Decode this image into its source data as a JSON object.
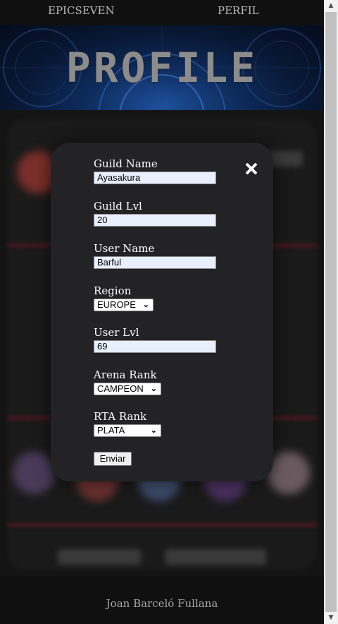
{
  "nav": {
    "home_link": "EPICSEVEN",
    "profile_link": "PERFIL"
  },
  "hero": {
    "title": "PROFILE"
  },
  "footer": {
    "author": "Joan Barceló Fullana"
  },
  "colors": {
    "modal_bg": "#232325",
    "input_autofill_bg": "#e8f0fe",
    "accent_line": "#5a1622"
  },
  "modal": {
    "close_icon": "close-icon",
    "fields": {
      "guild_name": {
        "label": "Guild Name",
        "value": "Ayasakura"
      },
      "guild_lvl": {
        "label": "Guild Lvl",
        "value": "20"
      },
      "user_name": {
        "label": "User Name",
        "value": "Barful"
      },
      "region": {
        "label": "Region",
        "selected": "EUROPE"
      },
      "user_lvl": {
        "label": "User Lvl",
        "value": "69"
      },
      "arena_rank": {
        "label": "Arena Rank",
        "selected": "CAMPEON"
      },
      "rta_rank": {
        "label": "RTA Rank",
        "selected": "PLATA"
      }
    },
    "submit_label": "Enviar"
  }
}
